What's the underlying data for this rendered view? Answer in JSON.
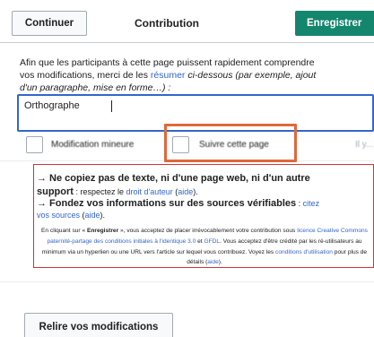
{
  "header": {
    "continue_label": "Continuer",
    "title": "Contribution",
    "save_label": "Enregistrer"
  },
  "help": {
    "line1": "Afin que les participants à cette page puissent rapidement comprendre",
    "line2_before": "vos modifications, merci de les ",
    "line2_link": "résumer",
    "line2_after": " ci-dessous (par exemple, ajout",
    "line3": "d'un paragraphe, mise en forme…) :"
  },
  "summary": {
    "value": "Orthographe",
    "placeholder": ""
  },
  "checkboxes": {
    "minor_label": "Modification mineure",
    "watch_label": "Suivre cette page",
    "truncated_label": "Il y..."
  },
  "warning": {
    "line1": "→ Ne copiez pas de texte, ni d'une page web, ni d'un autre",
    "line2_bold": "support",
    "line2_text": " : respectez le ",
    "line2_link1": "droit d'auteur",
    "line2_paren_open": " (",
    "line2_link2": "aide",
    "line2_paren_close": ").",
    "line3": "→ Fondez vos informations sur des sources vérifiables",
    "line3_colon": " : ",
    "line3_link": "citez",
    "line4_link1": "vos sources",
    "line4_paren_open": " (",
    "line4_link2": "aide",
    "line4_paren_close": ").",
    "legal_p1": "En cliquant sur « ",
    "legal_save": "Enregistrer",
    "legal_p2": " », vous acceptez de placer irrévocablement votre contribution sous ",
    "legal_license_link": "licence Creative Commons paternité-partage des conditions initiales à l'identique 3.0",
    "legal_p3": " et ",
    "legal_gfdl_link": "GFDL",
    "legal_p4": ". Vous acceptez d'être crédité par les ré-utilisateurs au minimum via un hyperlien ou une URL vers l'article sur lequel vous contribuez. Voyez les ",
    "legal_terms_link": "conditions d'utilisation",
    "legal_p5": " pour plus de détails (",
    "legal_help_link": "aide",
    "legal_p6": ")."
  },
  "footer": {
    "review_label": "Relire vos modifications"
  },
  "colors": {
    "save_button": "#14866d",
    "link": "#3366cc",
    "warning_border": "#d33333",
    "focus_border": "#3366cc",
    "highlight": "#e0683b"
  }
}
